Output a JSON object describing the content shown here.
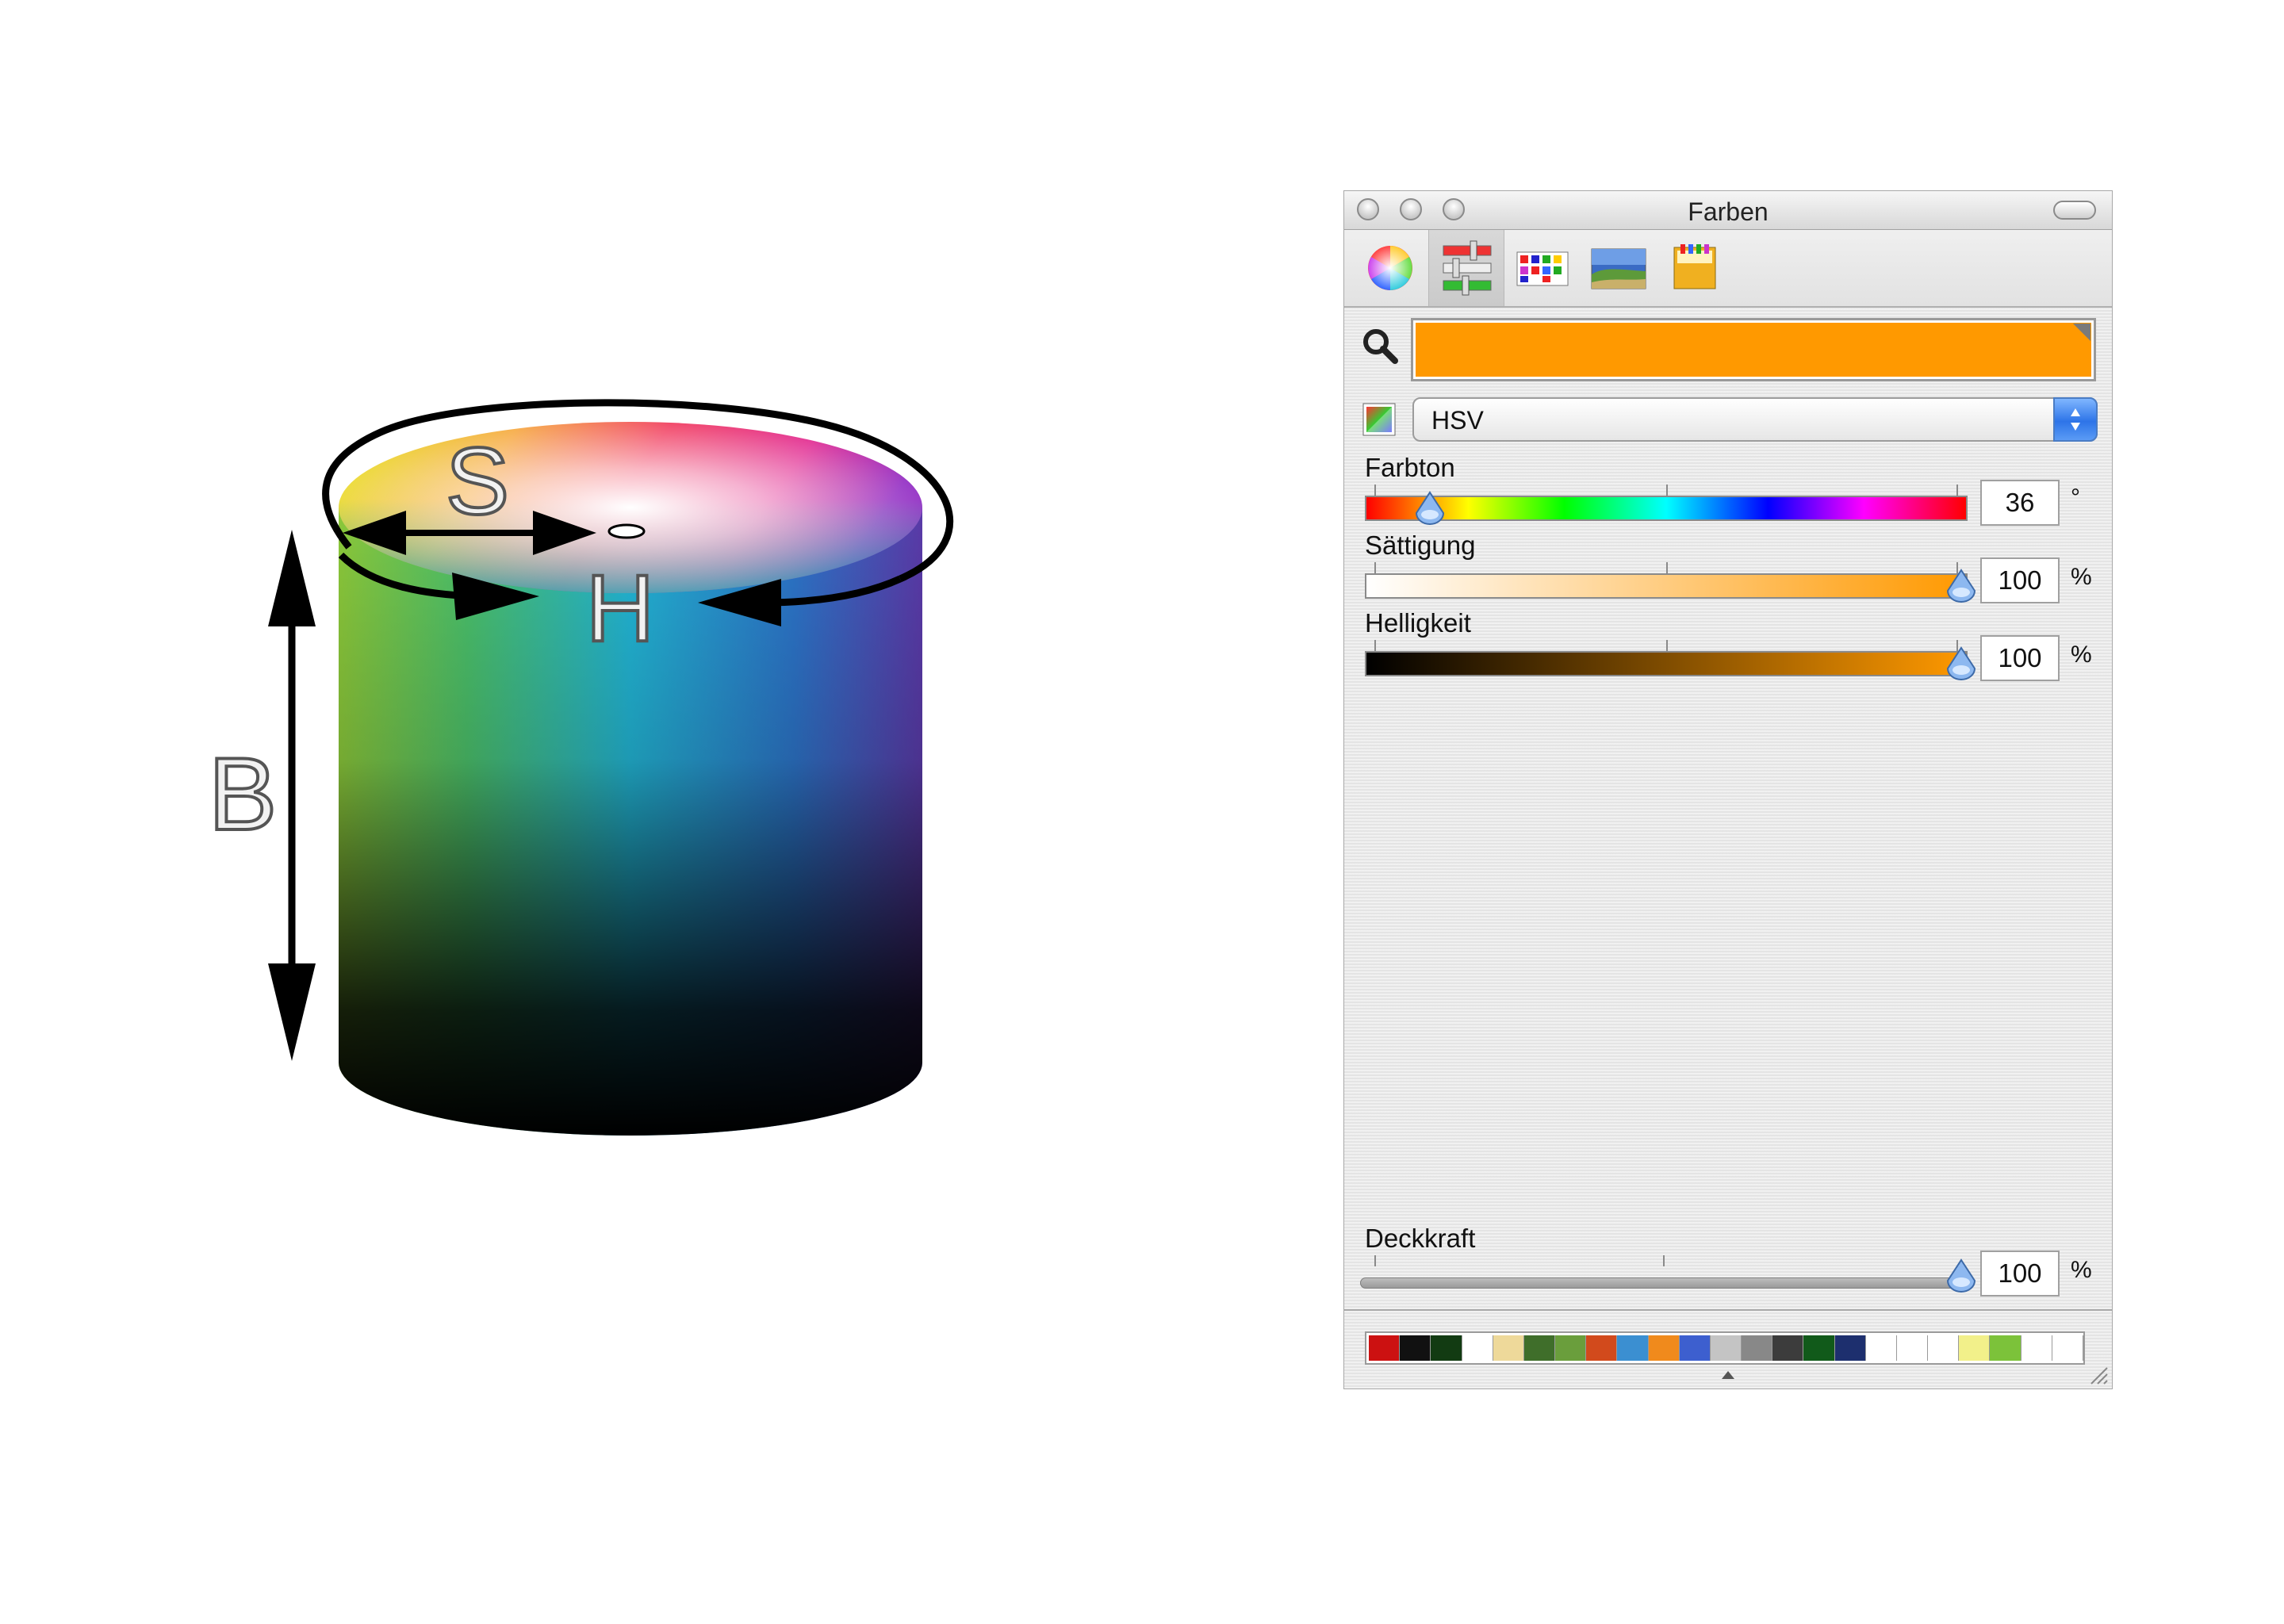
{
  "diagram": {
    "axis_labels": {
      "saturation": "S",
      "hue": "H",
      "brightness": "B"
    }
  },
  "window": {
    "title": "Farben"
  },
  "toolbar": {
    "tabs": [
      "color-wheel-icon",
      "color-sliders-icon",
      "color-palettes-icon",
      "image-palettes-icon",
      "crayons-icon"
    ],
    "active_tab": "color-sliders-icon"
  },
  "current_color": {
    "hex": "#ff9900"
  },
  "color_model": {
    "selected": "HSV"
  },
  "sliders": {
    "hue": {
      "label": "Farbton",
      "value": "36",
      "unit": "°",
      "fraction": 0.1
    },
    "saturation": {
      "label": "Sättigung",
      "value": "100",
      "unit": "%",
      "fraction": 1.0
    },
    "brightness": {
      "label": "Helligkeit",
      "value": "100",
      "unit": "%",
      "fraction": 1.0
    },
    "opacity": {
      "label": "Deckkraft",
      "value": "100",
      "unit": "%",
      "fraction": 1.0
    }
  },
  "swatches": [
    "#cc1111",
    "#111111",
    "#123b12",
    "#ffffff",
    "#eed99a",
    "#3f6e2a",
    "#6a9e3c",
    "#d24a1c",
    "#3b8fd1",
    "#f08a1c",
    "#3d5fcf",
    "#c4c4c4",
    "#888888",
    "#3c3c3c",
    "#115a1a",
    "#1d2f6e",
    "#ffffff",
    "#ffffff",
    "#ffffff",
    "#f2f08a",
    "#7cc23a",
    "#ffffff",
    "#ffffff"
  ]
}
